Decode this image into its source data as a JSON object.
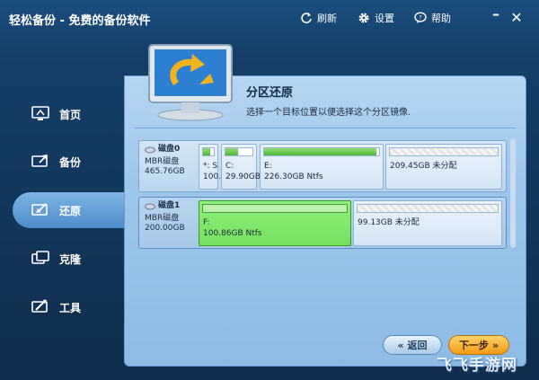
{
  "titlebar": {
    "app_title": "轻松备份 - 免费的备份软件",
    "refresh_label": "刷新",
    "settings_label": "设置",
    "help_label": "帮助"
  },
  "sidebar": {
    "items": [
      {
        "label": "首页",
        "icon": "monitor-home-icon",
        "active": false
      },
      {
        "label": "备份",
        "icon": "backup-icon",
        "active": false
      },
      {
        "label": "还原",
        "icon": "restore-icon",
        "active": true
      },
      {
        "label": "克隆",
        "icon": "clone-icon",
        "active": false
      },
      {
        "label": "工具",
        "icon": "tools-icon",
        "active": false
      }
    ]
  },
  "main": {
    "title": "分区还原",
    "description": "选择一个目标位置以便选择这个分区镜像."
  },
  "disks": [
    {
      "name": "磁盘0",
      "type": "MBR磁盘",
      "size": "465.76GB",
      "partitions": [
        {
          "letter": "*: S",
          "detail": "100.",
          "used_fraction": 0.7
        },
        {
          "letter": "C:",
          "detail": "29.90GB",
          "used_fraction": 0.45
        },
        {
          "letter": "E:",
          "detail": "226.30GB Ntfs",
          "used_fraction": 0.98
        },
        {
          "letter": "",
          "detail": "209.45GB 未分配",
          "used_fraction": 0
        }
      ]
    },
    {
      "name": "磁盘1",
      "type": "MBR磁盘",
      "size": "200.00GB",
      "partitions": [
        {
          "letter": "F:",
          "detail": "100.86GB Ntfs",
          "used_fraction": 0.0,
          "selected": true
        },
        {
          "letter": "",
          "detail": "99.13GB 未分配",
          "used_fraction": 0
        }
      ]
    }
  ],
  "buttons": {
    "back_label": "返回",
    "next_label": "下一步"
  },
  "watermark": "飞飞手游网",
  "colors": {
    "accent_green": "#74e060",
    "next_orange": "#f29a16",
    "title_bar": "#1b4e7e"
  }
}
